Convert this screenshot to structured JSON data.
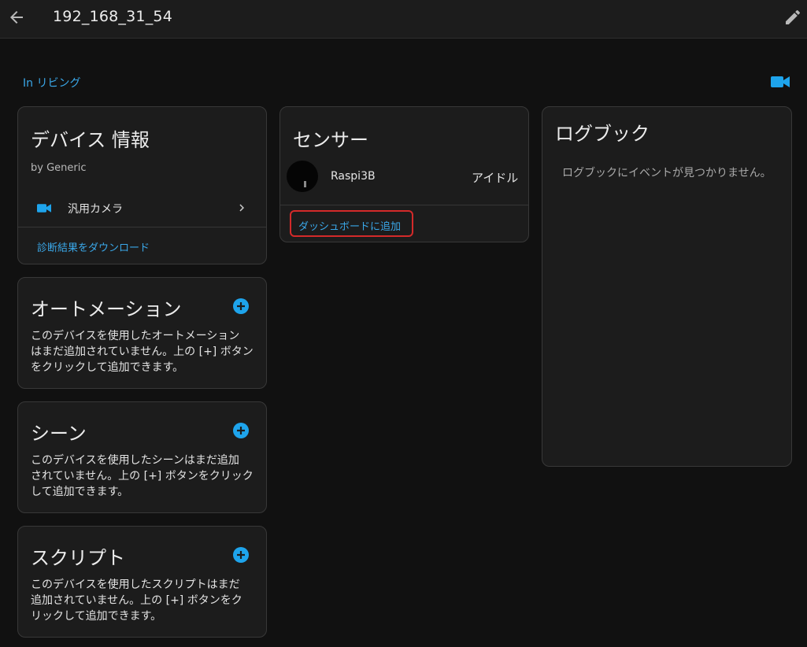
{
  "header": {
    "title": "192_168_31_54"
  },
  "area_link": "In リビング",
  "device_info": {
    "title": "デバイス 情報",
    "manufacturer": "by Generic",
    "entity_label": "汎用カメラ",
    "download_label": "診断結果をダウンロード"
  },
  "automation": {
    "title": "オートメーション",
    "text_lines": [
      "このデバイスを使用したオートメーション",
      "はまだ追加されていません。上の [+] ボタン",
      "をクリックして追加できます。"
    ]
  },
  "scene": {
    "title": "シーン",
    "text_lines": [
      "このデバイスを使用したシーンはまだ追加",
      "されていません。上の [+] ボタンをクリック",
      "して追加できます。"
    ]
  },
  "script": {
    "title": "スクリプト",
    "text_lines": [
      "このデバイスを使用したスクリプトはまだ",
      "追加されていません。上の [+] ボタンをク",
      "リックして追加できます。"
    ]
  },
  "sensor": {
    "title": "センサー",
    "entity_name": "Raspi3B",
    "entity_state": "アイドル",
    "add_to_dashboard": "ダッシュボードに追加"
  },
  "logbook": {
    "title": "ログブック",
    "empty_message": "ログブックにイベントが見つかりません。"
  },
  "colors": {
    "accent": "#3aa7e8",
    "highlight": "#d42a2a",
    "background": "#111111",
    "card": "#1c1c1c"
  },
  "icons": [
    "arrow-left-icon",
    "pencil-icon",
    "video-camera-icon",
    "chevron-right-icon",
    "plus-circle-icon"
  ]
}
